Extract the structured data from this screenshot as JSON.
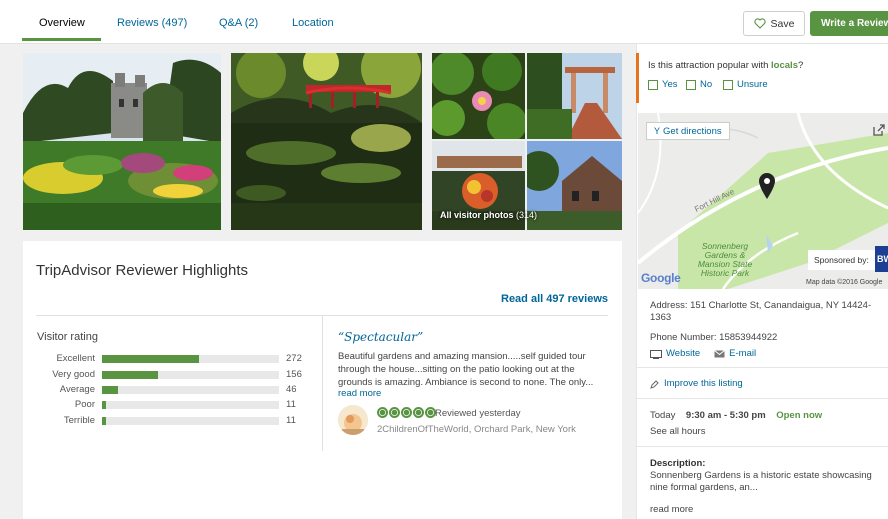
{
  "tabs": [
    {
      "label": "Overview",
      "active": true
    },
    {
      "label": "Reviews",
      "count": "(497)"
    },
    {
      "label": "Q&A",
      "count": "(2)"
    },
    {
      "label": "Location"
    }
  ],
  "actions": {
    "save_label": "Save",
    "write_label": "Write a Review"
  },
  "photos": {
    "caption": "All visitor photos",
    "count": "(314)"
  },
  "highlights": {
    "title": "TripAdvisor Reviewer Highlights",
    "read_all": "Read all 497 reviews",
    "visitor_rating_label": "Visitor rating",
    "ratings": [
      {
        "label": "Excellent",
        "count": "272",
        "value": 272
      },
      {
        "label": "Very good",
        "count": "156",
        "value": 156
      },
      {
        "label": "Average",
        "count": "46",
        "value": 46
      },
      {
        "label": "Poor",
        "count": "11",
        "value": 11
      },
      {
        "label": "Terrible",
        "count": "11",
        "value": 11
      }
    ],
    "review": {
      "title": "“Spectacular”",
      "text": "Beautiful gardens and amazing mansion.....self guided tour through the house...sitting on the patio looking out at the grounds is amazing. Ambiance is second to none. The only...",
      "read_more": "read more",
      "bubbles": 5,
      "date": "Reviewed yesterday",
      "reviewer": "2ChildrenOfTheWorld, Orchard Park, New York"
    }
  },
  "locals": {
    "question_prefix": "Is this attraction popular with ",
    "question_keyword": "locals",
    "question_suffix": "?",
    "options": [
      "Yes",
      "No",
      "Unsure"
    ]
  },
  "map": {
    "get_directions": "Get directions",
    "street": "Fort Hill Ave",
    "park_label": "Sonnenberg Gardens & Mansion State Historic Park",
    "sponsored": "Sponsored by:",
    "sponsor_logo": "BW",
    "credit": "Map data ©2016 Google",
    "google": "Google"
  },
  "details": {
    "address": "Address: 151 Charlotte St, Canandaigua, NY 14424-1363",
    "phone": "Phone Number: 15853944922",
    "website": "Website",
    "email": "E-mail",
    "improve": "Improve this listing",
    "hours_day": "Today",
    "hours_time": "9:30 am - 5:30 pm",
    "open_now": "Open now",
    "see_all_hours": "See all hours",
    "description_label": "Description:",
    "description_text": "Sonnenberg Gardens is a historic estate showcasing nine formal gardens, an...",
    "read_more": "read more"
  },
  "colors": {
    "accent_green": "#589442",
    "link_blue": "#006699",
    "locals_bar": "#e8731e"
  }
}
